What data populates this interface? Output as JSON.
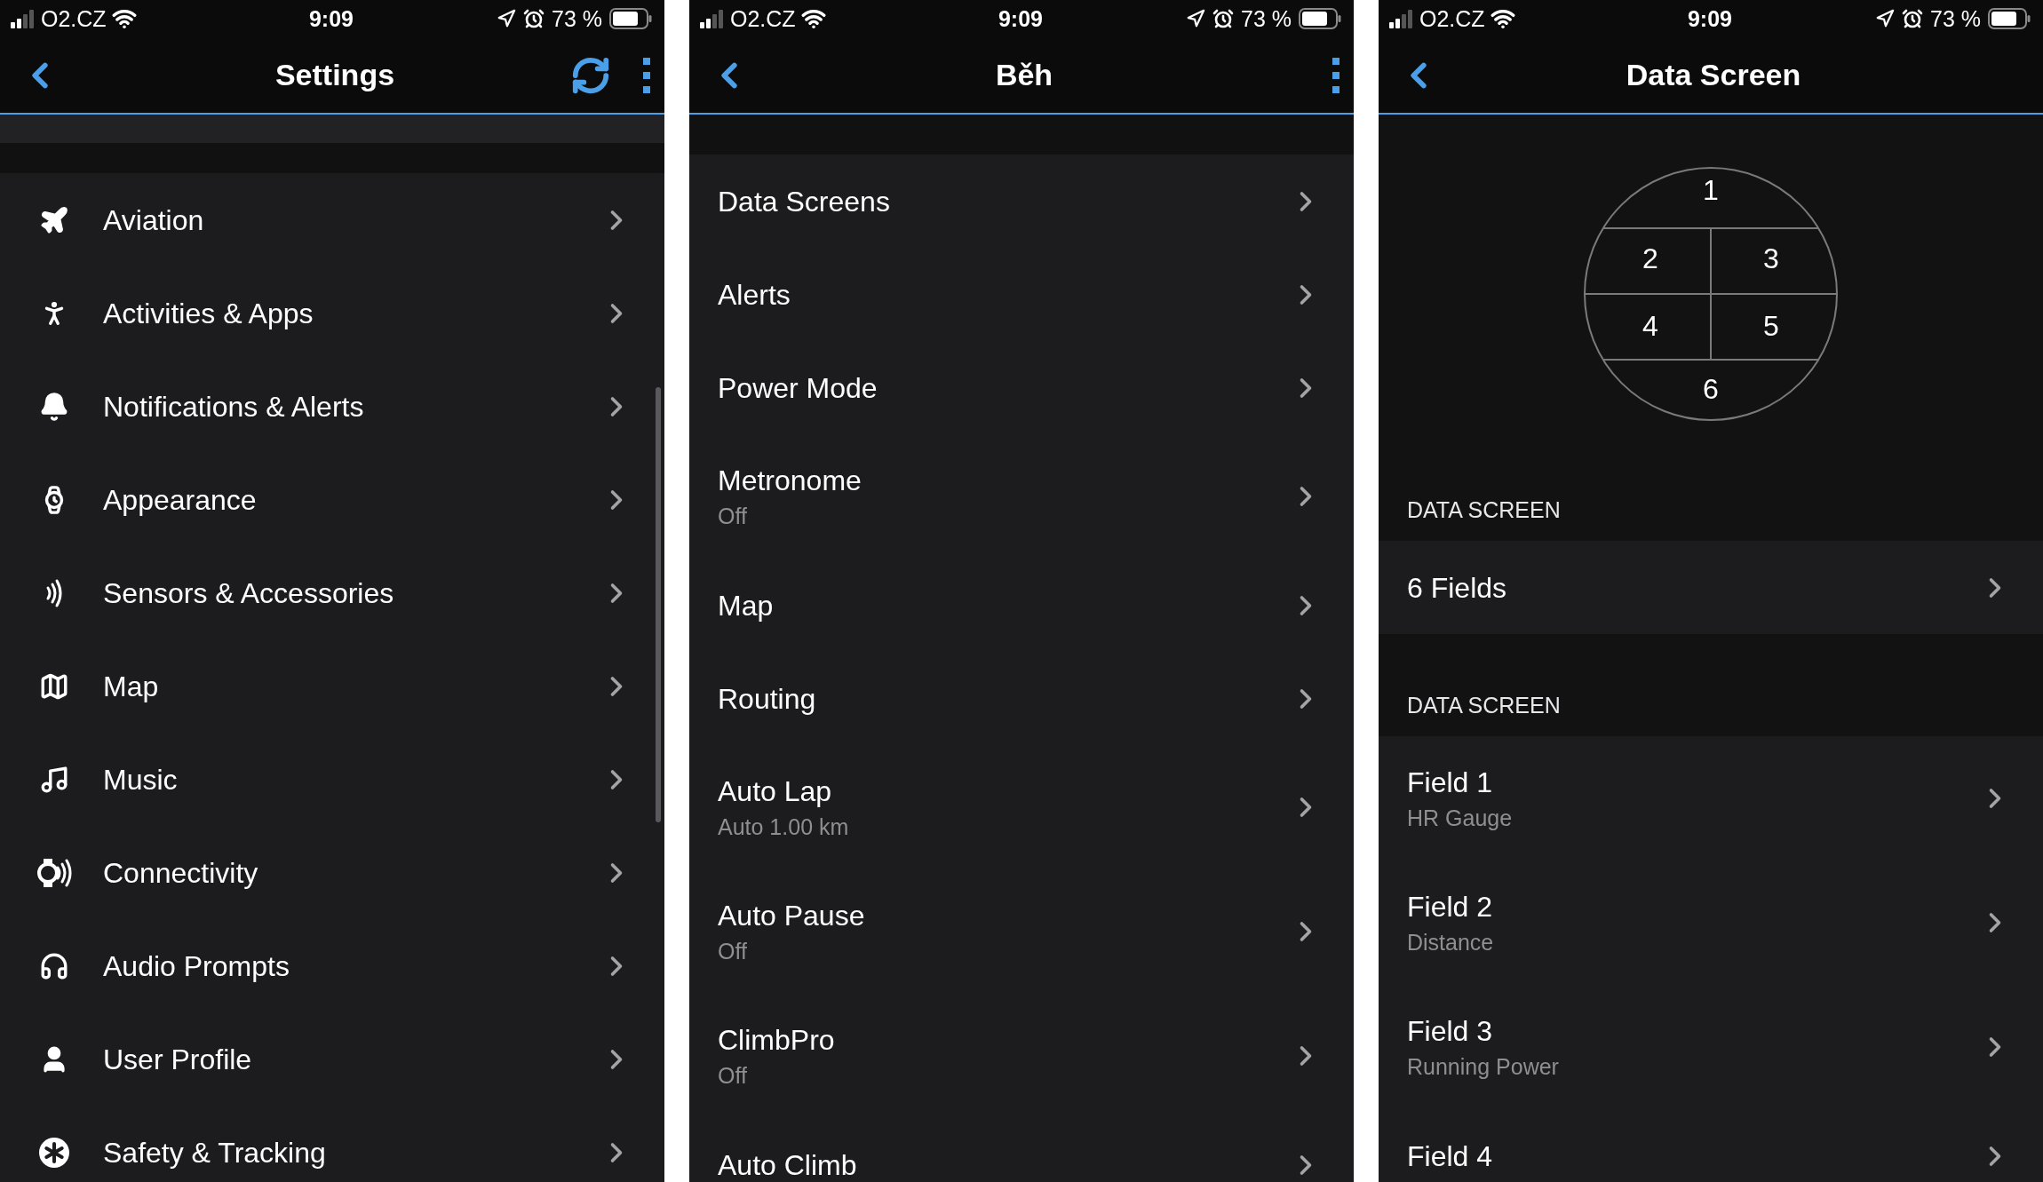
{
  "screens": [
    {
      "kind": "menu",
      "status_bar": {
        "carrier": "O2.CZ",
        "time": "9:09",
        "battery": "73 %"
      },
      "title": "Settings",
      "items": [
        {
          "label": "Aviation"
        },
        {
          "label": "Activities & Apps"
        },
        {
          "label": "Notifications & Alerts"
        },
        {
          "label": "Appearance"
        },
        {
          "label": "Sensors & Accessories"
        },
        {
          "label": "Map"
        },
        {
          "label": "Music"
        },
        {
          "label": "Connectivity"
        },
        {
          "label": "Audio Prompts"
        },
        {
          "label": "User Profile"
        },
        {
          "label": "Safety & Tracking"
        }
      ]
    },
    {
      "kind": "submenu",
      "status_bar": {
        "carrier": "O2.CZ",
        "time": "9:09",
        "battery": "73 %"
      },
      "title": "Běh",
      "items": [
        {
          "label": "Data Screens"
        },
        {
          "label": "Alerts"
        },
        {
          "label": "Power Mode"
        },
        {
          "label": "Metronome",
          "value": "Off"
        },
        {
          "label": "Map"
        },
        {
          "label": "Routing"
        },
        {
          "label": "Auto Lap",
          "value": "Auto 1.00 km"
        },
        {
          "label": "Auto Pause",
          "value": "Off"
        },
        {
          "label": "ClimbPro",
          "value": "Off"
        },
        {
          "label": "Auto Climb"
        }
      ]
    },
    {
      "kind": "data_screen",
      "status_bar": {
        "carrier": "O2.CZ",
        "time": "9:09",
        "battery": "73 %"
      },
      "title": "Data Screen",
      "layout_cells": [
        "1",
        "2",
        "3",
        "4",
        "5",
        "6"
      ],
      "sections": [
        {
          "header": "DATA SCREEN",
          "items": [
            {
              "label": "6 Fields"
            }
          ]
        },
        {
          "header": "DATA SCREEN",
          "items": [
            {
              "label": "Field 1",
              "value": "HR Gauge"
            },
            {
              "label": "Field 2",
              "value": "Distance"
            },
            {
              "label": "Field 3",
              "value": "Running Power"
            },
            {
              "label": "Field 4"
            }
          ]
        }
      ]
    }
  ]
}
